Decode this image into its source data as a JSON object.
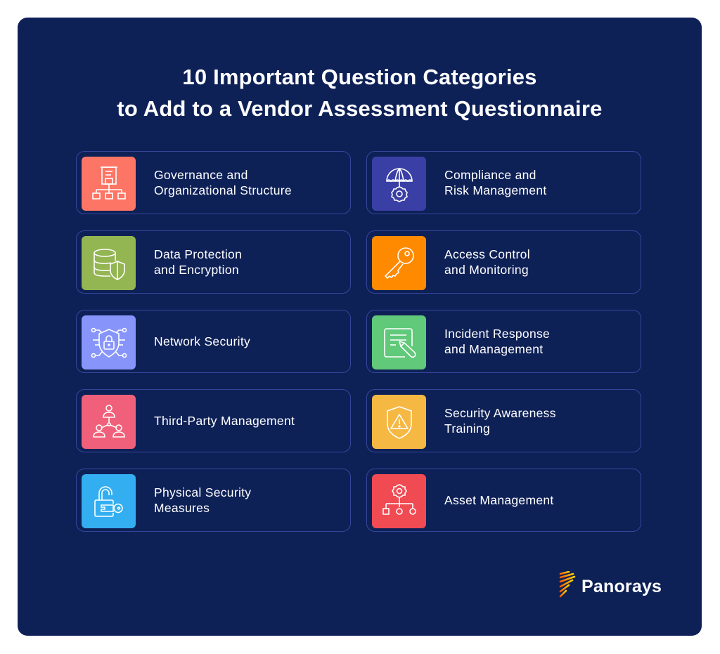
{
  "title": {
    "line1": "10 Important Question Categories",
    "line2": "to Add to a Vendor Assessment Questionnaire"
  },
  "categories": [
    {
      "line1": "Governance and",
      "line2": "Organizational Structure",
      "icon": "org-chart-icon",
      "color": "#fd7565"
    },
    {
      "line1": "Compliance and",
      "line2": "Risk Management",
      "icon": "umbrella-gear-icon",
      "color": "#3a3fa6"
    },
    {
      "line1": "Data Protection",
      "line2": "and Encryption",
      "icon": "database-shield-icon",
      "color": "#93b552"
    },
    {
      "line1": "Access Control",
      "line2": "and Monitoring",
      "icon": "key-icon",
      "color": "#ff8a00"
    },
    {
      "line1": "Network Security",
      "line2": "",
      "icon": "network-shield-lock-icon",
      "color": "#8795fb"
    },
    {
      "line1": "Incident Response",
      "line2": "and Management",
      "icon": "document-edit-icon",
      "color": "#60c97a"
    },
    {
      "line1": "Third-Party Management",
      "line2": "",
      "icon": "people-network-icon",
      "color": "#f0607a"
    },
    {
      "line1": "Security Awareness",
      "line2": "Training",
      "icon": "warning-shield-icon",
      "color": "#f5b843"
    },
    {
      "line1": "Physical Security",
      "line2": "Measures",
      "icon": "padlock-key-icon",
      "color": "#33aef0"
    },
    {
      "line1": "Asset Management",
      "line2": "",
      "icon": "gear-hierarchy-icon",
      "color": "#f04a53"
    }
  ],
  "brand": {
    "name": "Panorays",
    "colors": [
      "#ffd200",
      "#ff6a00"
    ]
  }
}
